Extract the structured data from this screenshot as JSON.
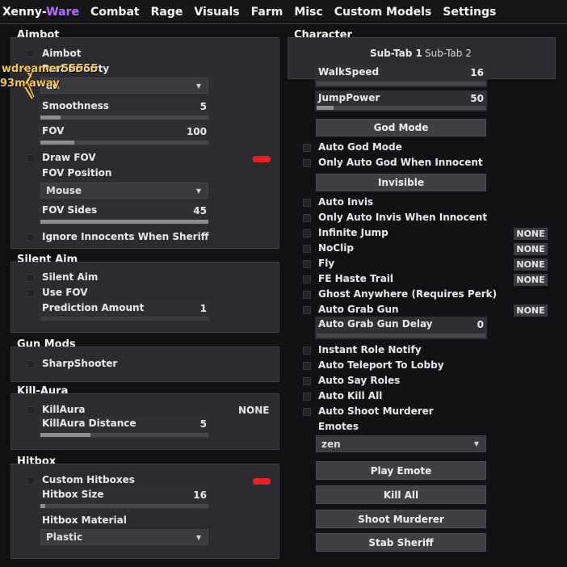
{
  "topbar": {
    "brand_main": "Xenny-",
    "brand_accent": "Ware",
    "tabs": [
      "Combat",
      "Rage",
      "Visuals",
      "Farm",
      "Misc",
      "Custom Models",
      "Settings"
    ]
  },
  "overlay": {
    "player_name": "wdreamer55555",
    "distance": "93m away"
  },
  "aimbot": {
    "title": "Aimbot",
    "aimbot_label": "Aimbot",
    "part_label": "Part Priority",
    "part_value": "ad",
    "smoothness_label": "Smoothness",
    "smoothness_value": "5",
    "smoothness_fraction": 0.12,
    "fov_label": "FOV",
    "fov_value": "100",
    "fov_fraction": 0.2,
    "draw_fov_label": "Draw FOV",
    "fov_position_label": "FOV Position",
    "fov_position_value": "Mouse",
    "fov_sides_label": "FOV Sides",
    "fov_sides_value": "45",
    "fov_sides_fraction": 1.0,
    "ignore_label": "Ignore Innocents When Sheriff"
  },
  "silent_aim": {
    "title": "Silent Aim",
    "silent_label": "Silent Aim",
    "use_fov_label": "Use FOV",
    "prediction_label": "Prediction Amount",
    "prediction_value": "1"
  },
  "gun_mods": {
    "title": "Gun Mods",
    "sharpshooter_label": "SharpShooter"
  },
  "kill_aura": {
    "title": "Kill-Aura",
    "killaura_label": "KillAura",
    "killaura_bind": "NONE",
    "distance_label": "KillAura Distance",
    "distance_value": "5",
    "distance_fraction": 0.3
  },
  "hitbox": {
    "title": "Hitbox",
    "custom_label": "Custom Hitboxes",
    "size_label": "Hitbox Size",
    "size_value": "16",
    "size_fraction": 0.03,
    "material_label": "Hitbox Material",
    "material_value": "Plastic"
  },
  "character": {
    "title": "Character",
    "subtabs": [
      "Sub-Tab 1",
      "Sub-Tab 2"
    ],
    "walkspeed_label": "WalkSpeed",
    "walkspeed_value": "16",
    "walkspeed_fraction": 0.0,
    "jumppower_label": "JumpPower",
    "jumppower_value": "50",
    "jumppower_fraction": 0.1,
    "god_mode_button": "God Mode",
    "auto_god_label": "Auto God Mode",
    "only_auto_god_label": "Only Auto God When Innocent",
    "invisible_button": "Invisible",
    "auto_invis_label": "Auto Invis",
    "only_auto_invis_label": "Only Auto Invis When Innocent",
    "infinite_jump_label": "Infinite Jump",
    "infinite_jump_bind": "NONE",
    "noclip_label": "NoClip",
    "noclip_bind": "NONE",
    "fly_label": "Fly",
    "fly_bind": "NONE",
    "fe_haste_label": "FE Haste Trail",
    "fe_haste_bind": "NONE",
    "ghost_label": "Ghost Anywhere (Requires Perk)",
    "auto_grab_label": "Auto Grab Gun",
    "auto_grab_bind": "NONE",
    "grab_delay_label": "Auto Grab Gun Delay",
    "grab_delay_value": "0",
    "grab_delay_fraction": 0.0,
    "instant_role_label": "Instant Role Notify",
    "auto_teleport_label": "Auto Teleport To Lobby",
    "auto_say_label": "Auto Say Roles",
    "auto_kill_label": "Auto Kill All",
    "auto_shoot_label": "Auto Shoot Murderer",
    "emotes_label": "Emotes",
    "emote_value": "zen",
    "play_emote_button": "Play Emote",
    "kill_all_button": "Kill All",
    "shoot_murderer_button": "Shoot Murderer",
    "stab_sheriff_button": "Stab Sheriff"
  },
  "colors": {
    "accent": "#b56cff",
    "toggle_on": "#e81f1f",
    "overlay_text": "#f6c945"
  }
}
